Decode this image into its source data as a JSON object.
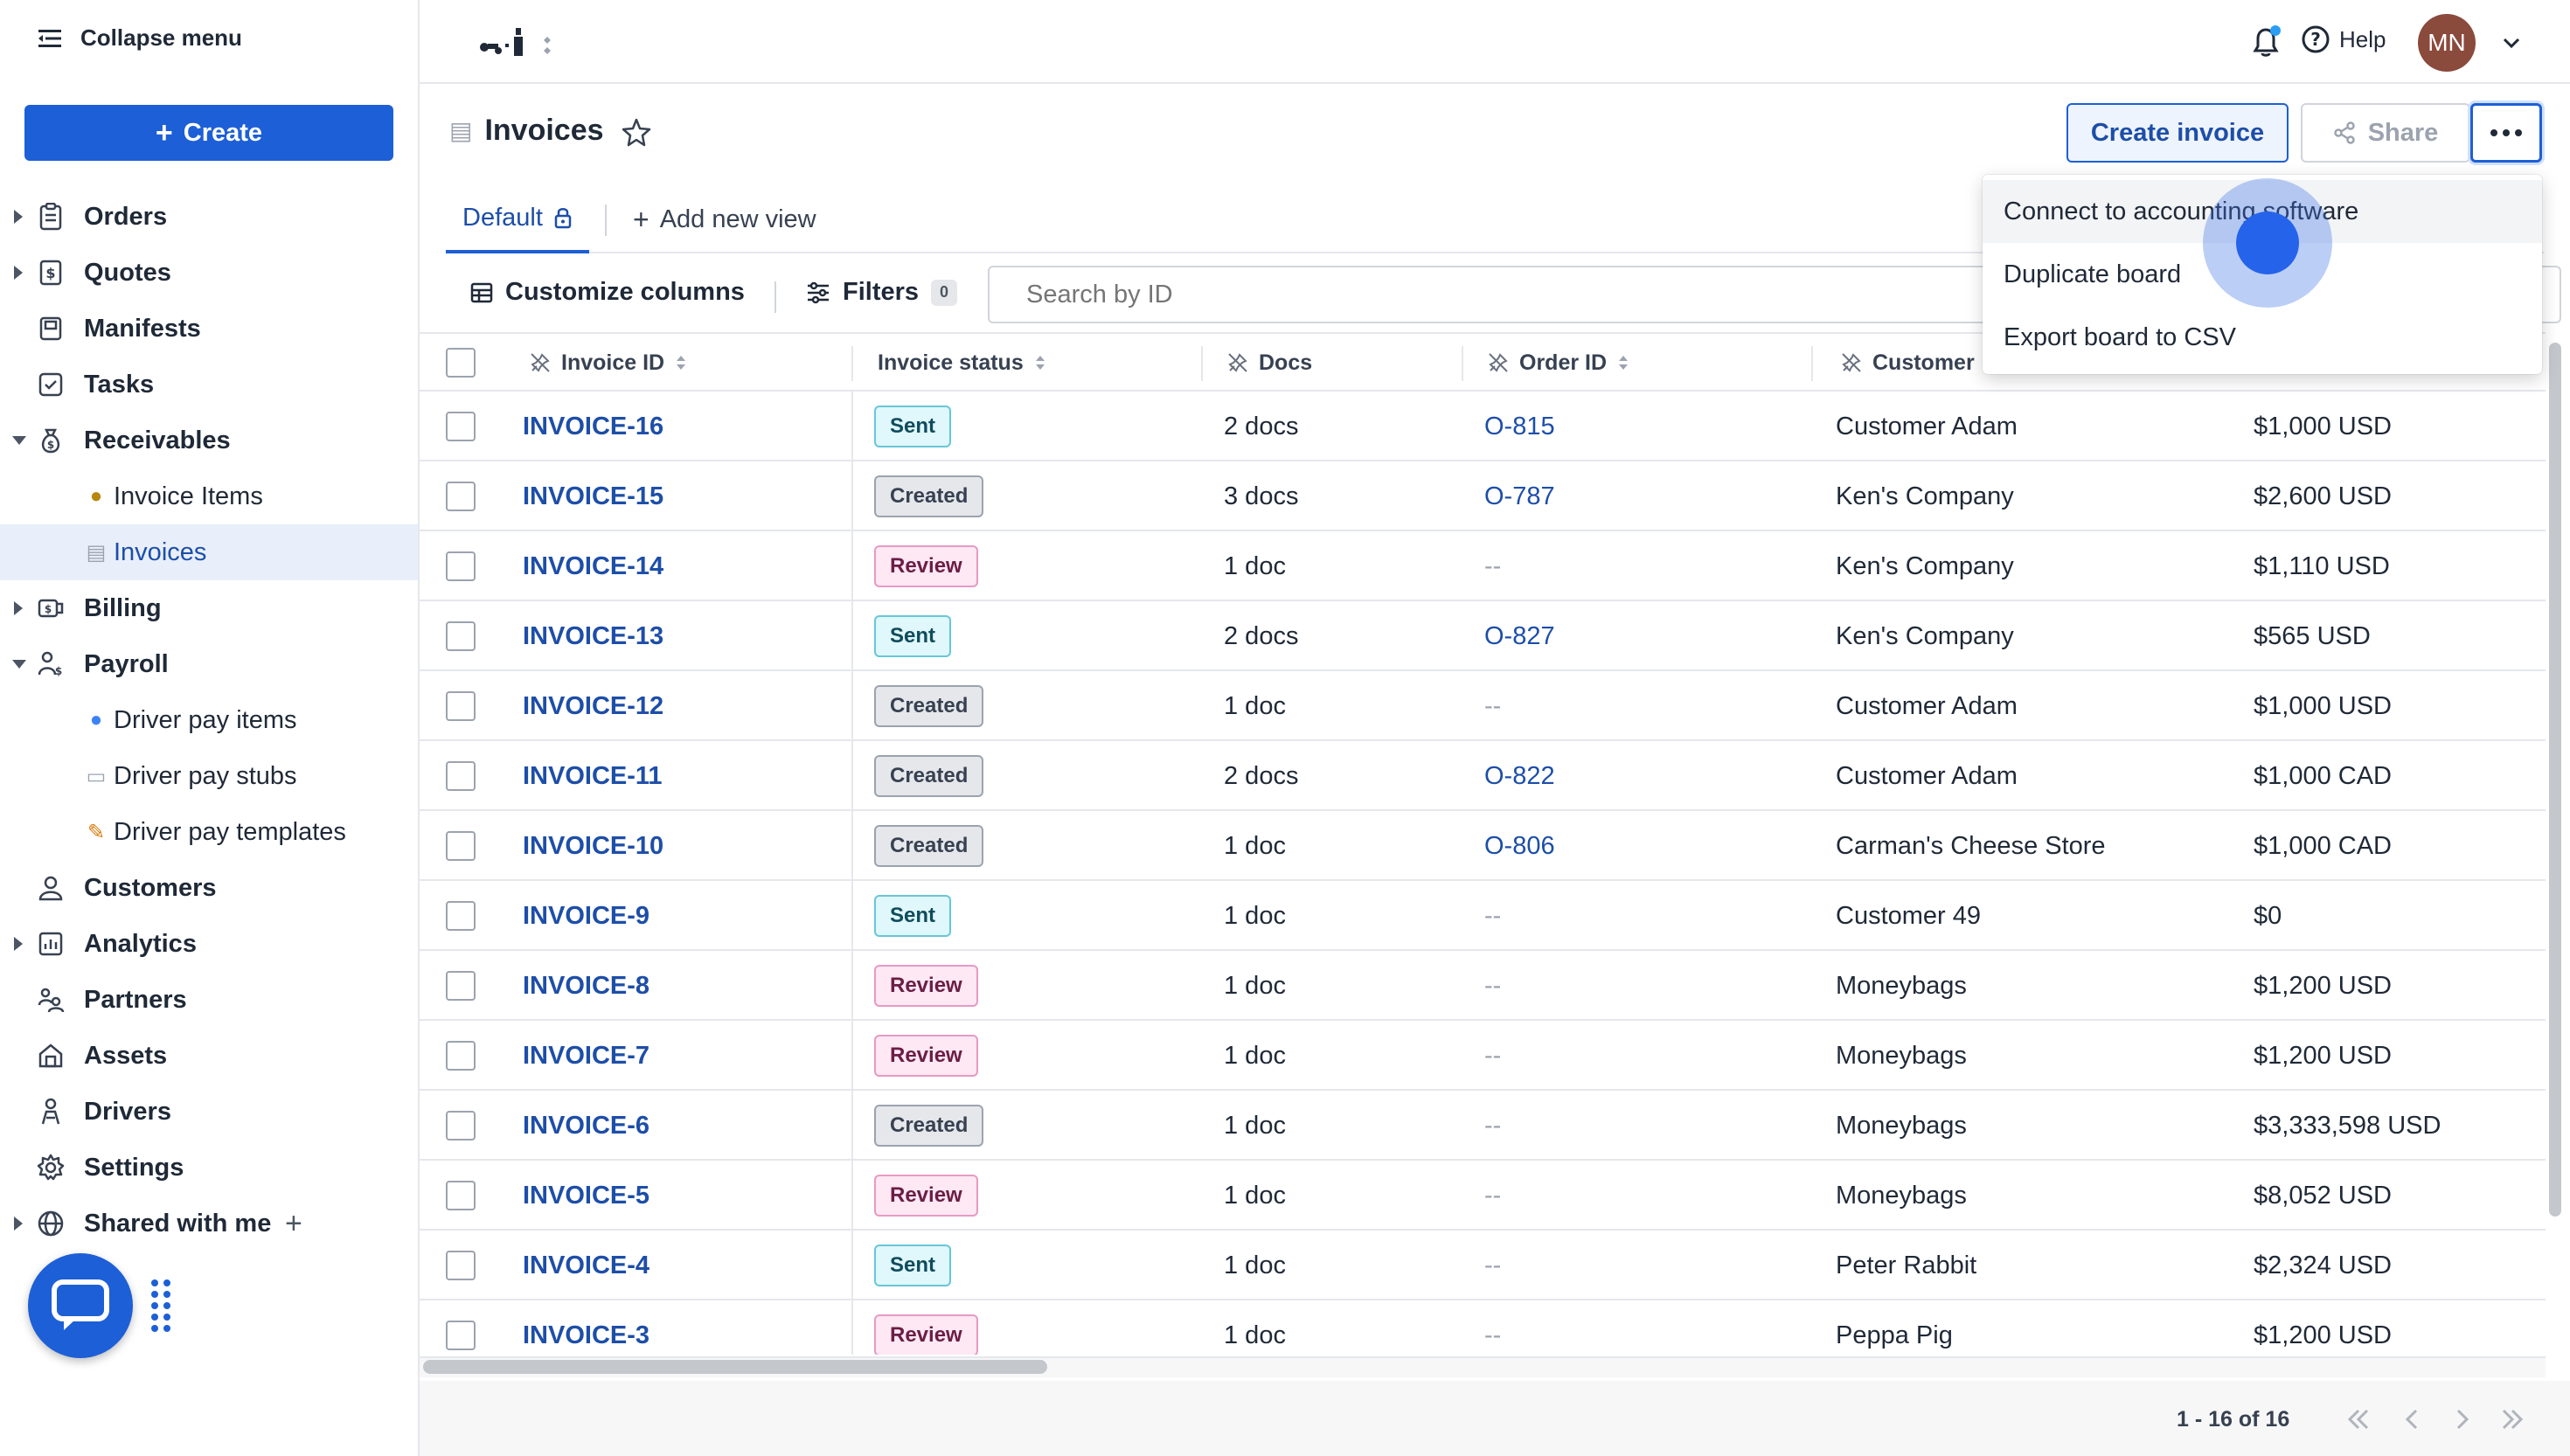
{
  "sidebar": {
    "collapse_label": "Collapse menu",
    "create_label": "Create",
    "items": [
      {
        "label": "Orders",
        "icon": "clipboard-icon",
        "caret": "closed"
      },
      {
        "label": "Quotes",
        "icon": "quote-icon",
        "caret": "closed"
      },
      {
        "label": "Manifests",
        "icon": "manifest-icon",
        "caret": "none"
      },
      {
        "label": "Tasks",
        "icon": "checkbox-icon",
        "caret": "none"
      },
      {
        "label": "Receivables",
        "icon": "money-bag-icon",
        "caret": "open"
      },
      {
        "label": "Invoice Items",
        "icon": "money-bag-emoji-icon",
        "sub": true
      },
      {
        "label": "Invoices",
        "icon": "receipt-emoji-icon",
        "sub": true,
        "active": true
      },
      {
        "label": "Billing",
        "icon": "billing-icon",
        "caret": "closed"
      },
      {
        "label": "Payroll",
        "icon": "payroll-icon",
        "caret": "open"
      },
      {
        "label": "Driver pay items",
        "icon": "person-emoji-icon",
        "sub": true
      },
      {
        "label": "Driver pay stubs",
        "icon": "stub-emoji-icon",
        "sub": true
      },
      {
        "label": "Driver pay templates",
        "icon": "memo-emoji-icon",
        "sub": true
      },
      {
        "label": "Customers",
        "icon": "customers-icon",
        "caret": "none"
      },
      {
        "label": "Analytics",
        "icon": "analytics-icon",
        "caret": "closed"
      },
      {
        "label": "Partners",
        "icon": "partners-icon",
        "caret": "none"
      },
      {
        "label": "Assets",
        "icon": "assets-icon",
        "caret": "none"
      },
      {
        "label": "Drivers",
        "icon": "drivers-icon",
        "caret": "none"
      },
      {
        "label": "Settings",
        "icon": "gear-icon",
        "caret": "none"
      },
      {
        "label": "Shared with me",
        "icon": "globe-icon",
        "caret": "closed",
        "plus": true
      }
    ]
  },
  "header": {
    "help_label": "Help",
    "avatar_initials": "MN"
  },
  "page": {
    "title": "Invoices",
    "create_invoice_label": "Create invoice",
    "share_label": "Share"
  },
  "tabs": {
    "default_label": "Default",
    "add_view_label": "Add new view"
  },
  "toolbar": {
    "customize_label": "Customize columns",
    "filters_label": "Filters",
    "filters_count": "0",
    "search_placeholder": "Search by ID"
  },
  "table": {
    "columns": [
      "Invoice ID",
      "Invoice status",
      "Docs",
      "Order ID",
      "Customer"
    ],
    "rows": [
      {
        "id": "INVOICE-16",
        "status": "Sent",
        "docs": "2 docs",
        "order": "O-815",
        "customer": "Customer Adam",
        "amount": "$1,000 USD"
      },
      {
        "id": "INVOICE-15",
        "status": "Created",
        "docs": "3 docs",
        "order": "O-787",
        "customer": "Ken's Company",
        "amount": "$2,600 USD"
      },
      {
        "id": "INVOICE-14",
        "status": "Review",
        "docs": "1 doc",
        "order": "--",
        "customer": "Ken's Company",
        "amount": "$1,110 USD"
      },
      {
        "id": "INVOICE-13",
        "status": "Sent",
        "docs": "2 docs",
        "order": "O-827",
        "customer": "Ken's Company",
        "amount": "$565 USD"
      },
      {
        "id": "INVOICE-12",
        "status": "Created",
        "docs": "1 doc",
        "order": "--",
        "customer": "Customer Adam",
        "amount": "$1,000 USD"
      },
      {
        "id": "INVOICE-11",
        "status": "Created",
        "docs": "2 docs",
        "order": "O-822",
        "customer": "Customer Adam",
        "amount": "$1,000 CAD"
      },
      {
        "id": "INVOICE-10",
        "status": "Created",
        "docs": "1 doc",
        "order": "O-806",
        "customer": "Carman's Cheese Store",
        "amount": "$1,000 CAD"
      },
      {
        "id": "INVOICE-9",
        "status": "Sent",
        "docs": "1 doc",
        "order": "--",
        "customer": "Customer 49",
        "amount": "$0"
      },
      {
        "id": "INVOICE-8",
        "status": "Review",
        "docs": "1 doc",
        "order": "--",
        "customer": "Moneybags",
        "amount": "$1,200 USD"
      },
      {
        "id": "INVOICE-7",
        "status": "Review",
        "docs": "1 doc",
        "order": "--",
        "customer": "Moneybags",
        "amount": "$1,200 USD"
      },
      {
        "id": "INVOICE-6",
        "status": "Created",
        "docs": "1 doc",
        "order": "--",
        "customer": "Moneybags",
        "amount": "$3,333,598 USD"
      },
      {
        "id": "INVOICE-5",
        "status": "Review",
        "docs": "1 doc",
        "order": "--",
        "customer": "Moneybags",
        "amount": "$8,052 USD"
      },
      {
        "id": "INVOICE-4",
        "status": "Sent",
        "docs": "1 doc",
        "order": "--",
        "customer": "Peter Rabbit",
        "amount": "$2,324 USD"
      },
      {
        "id": "INVOICE-3",
        "status": "Review",
        "docs": "1 doc",
        "order": "--",
        "customer": "Peppa Pig",
        "amount": "$1,200 USD"
      }
    ]
  },
  "footer": {
    "pager_label": "1 - 16 of 16"
  },
  "menu": {
    "items": [
      "Connect to accounting software",
      "Duplicate board",
      "Export board to CSV"
    ]
  },
  "colors": {
    "accent": "#1d5fd6",
    "link": "#1d4ea8"
  }
}
